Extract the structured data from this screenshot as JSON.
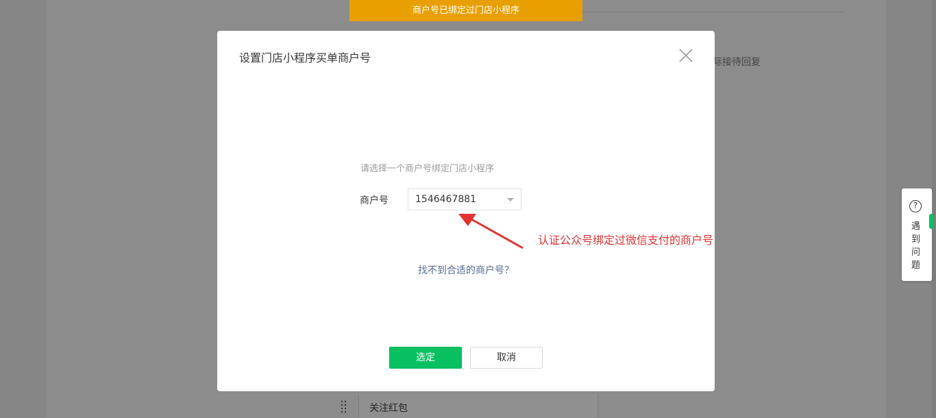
{
  "toast": {
    "text": "商户号已绑定过门店小程序"
  },
  "background": {
    "partial_text": "际接待回复",
    "row_label": "关注红包"
  },
  "modal": {
    "title": "设置门店小程序买单商户号",
    "hint": "请选择一个商户号绑定门店小程序",
    "field_label": "商户号",
    "select_value": "1546467881",
    "help_link": "找不到合适的商户号？",
    "confirm_label": "选定",
    "cancel_label": "取消",
    "close_icon": "close-icon"
  },
  "annotation": {
    "text": "认证公众号绑定过微信支付的商户号",
    "color": "#e23232"
  },
  "help_widget": {
    "icon": "question-circle-icon",
    "icon_glyph": "?",
    "label": "遇到问题"
  },
  "colors": {
    "primary": "#07c160",
    "toast": "#e8a000",
    "link": "#576b95"
  }
}
